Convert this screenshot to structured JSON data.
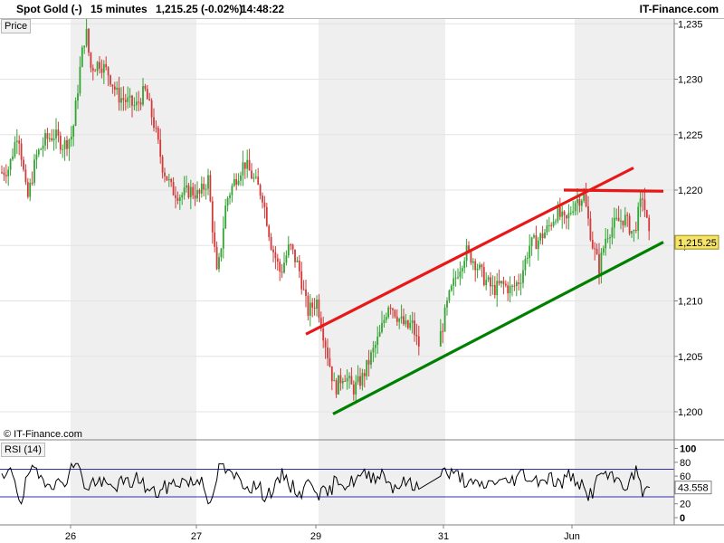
{
  "header": {
    "instrument": "Spot Gold (-)",
    "interval": "15 minutes",
    "price_change": "1,215.25 (-0.02%)",
    "time": "14:48:22",
    "brand": "IT-Finance.com"
  },
  "price_panel": {
    "label": "Price",
    "copyright": "© IT-Finance.com"
  },
  "rsi_panel": {
    "label": "RSI (14)"
  },
  "chart_data": [
    {
      "type": "candlestick",
      "title": "Spot Gold (-)",
      "interval": "15 minutes",
      "ylim": [
        1196,
        1235.5
      ],
      "y_ticks": [
        1200,
        1205,
        1210,
        1215,
        1220,
        1225,
        1230,
        1235
      ],
      "y_tick_labels": [
        "1,200",
        "1,205",
        "1,210",
        "1,215",
        "1,220",
        "1,225",
        "1,230",
        "1,235"
      ],
      "x_tick_labels": [
        "26",
        "27",
        "29",
        "31",
        "Jun"
      ],
      "last_price": 1215.25,
      "last_price_label": "1,215.25",
      "up_color": "#33a333",
      "down_color": "#d23a3a",
      "grid": true,
      "path": [
        [
          0,
          1221.5
        ],
        [
          10,
          1222
        ],
        [
          20,
          1225.5
        ],
        [
          30,
          1219
        ],
        [
          40,
          1223
        ],
        [
          50,
          1224.5
        ],
        [
          60,
          1225
        ],
        [
          70,
          1224
        ],
        [
          80,
          1225
        ],
        [
          90,
          1232
        ],
        [
          95,
          1234.5
        ],
        [
          100,
          1231
        ],
        [
          110,
          1231.5
        ],
        [
          120,
          1230.5
        ],
        [
          130,
          1228.5
        ],
        [
          140,
          1228
        ],
        [
          150,
          1227.5
        ],
        [
          160,
          1229
        ],
        [
          170,
          1226
        ],
        [
          180,
          1222
        ],
        [
          190,
          1220
        ],
        [
          200,
          1219.5
        ],
        [
          210,
          1220
        ],
        [
          220,
          1219.5
        ],
        [
          230,
          1221
        ],
        [
          240,
          1212
        ],
        [
          250,
          1219
        ],
        [
          260,
          1221
        ],
        [
          270,
          1222.5
        ],
        [
          280,
          1221
        ],
        [
          290,
          1219.5
        ],
        [
          300,
          1215
        ],
        [
          310,
          1212.5
        ],
        [
          320,
          1215
        ],
        [
          330,
          1213
        ],
        [
          340,
          1209
        ],
        [
          350,
          1210
        ],
        [
          360,
          1206
        ],
        [
          370,
          1202
        ],
        [
          380,
          1203.5
        ],
        [
          390,
          1202
        ],
        [
          400,
          1203
        ],
        [
          410,
          1205
        ],
        [
          420,
          1207
        ],
        [
          430,
          1210
        ],
        [
          440,
          1208.5
        ],
        [
          450,
          1207.5
        ],
        [
          455,
          1208
        ],
        [
          462,
          1206
        ],
        [
          487,
          1207
        ],
        [
          495,
          1210
        ],
        [
          505,
          1212.5
        ],
        [
          515,
          1214.5
        ],
        [
          525,
          1213.5
        ],
        [
          535,
          1212
        ],
        [
          545,
          1211
        ],
        [
          555,
          1211.5
        ],
        [
          565,
          1211
        ],
        [
          575,
          1212
        ],
        [
          585,
          1215
        ],
        [
          595,
          1215.5
        ],
        [
          605,
          1216.5
        ],
        [
          615,
          1218
        ],
        [
          625,
          1217
        ],
        [
          635,
          1219
        ],
        [
          645,
          1219.5
        ],
        [
          655,
          1215
        ],
        [
          662,
          1213
        ],
        [
          670,
          1216
        ],
        [
          680,
          1217
        ],
        [
          690,
          1217.5
        ],
        [
          700,
          1216
        ],
        [
          710,
          1219.5
        ],
        [
          713,
          1218
        ],
        [
          718,
          1215.25
        ]
      ],
      "gaps": [
        [
          463,
          486
        ]
      ],
      "trendlines": [
        {
          "name": "upper-channel",
          "color": "#e81818",
          "x": [
            338,
            700
          ],
          "y": [
            1207,
            1222
          ]
        },
        {
          "name": "resistance",
          "color": "#e81818",
          "x": [
            623,
            733
          ],
          "y": [
            1220,
            1219.9
          ]
        },
        {
          "name": "lower-channel",
          "color": "#008000",
          "x": [
            368,
            733
          ],
          "y": [
            1199.8,
            1215.3
          ]
        }
      ]
    },
    {
      "type": "line",
      "title": "RSI (14)",
      "ylim": [
        0,
        100
      ],
      "y_ticks": [
        0,
        20,
        40,
        60,
        80,
        100
      ],
      "y_tick_labels": [
        "0",
        "20",
        "40",
        "60",
        "80",
        "100"
      ],
      "overbought": 70,
      "oversold": 30,
      "last_value": 43.558,
      "last_value_label": "43.558",
      "line_color": "#000000",
      "band_color": "#3030b0"
    }
  ]
}
